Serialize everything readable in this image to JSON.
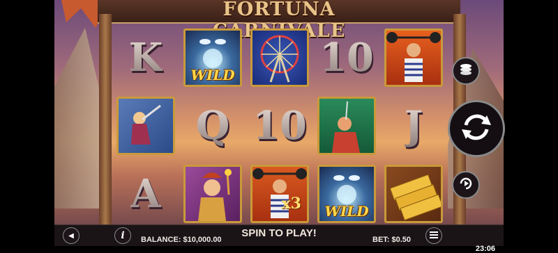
{
  "game": {
    "title": "FORTUNA CARNIVALE"
  },
  "reels": [
    [
      {
        "symbol": "K",
        "kind": "letter"
      },
      {
        "symbol": "aerialist",
        "kind": "tile"
      },
      {
        "symbol": "A",
        "kind": "letter"
      }
    ],
    [
      {
        "symbol": "fortune-teller",
        "kind": "tile",
        "label": "WILD"
      },
      {
        "symbol": "Q",
        "kind": "letter"
      },
      {
        "symbol": "fire-eater",
        "kind": "tile"
      }
    ],
    [
      {
        "symbol": "ferris-wheel",
        "kind": "tile"
      },
      {
        "symbol": "10",
        "kind": "letter"
      },
      {
        "symbol": "strongman",
        "kind": "tile",
        "label": "x3"
      }
    ],
    [
      {
        "symbol": "10",
        "kind": "letter"
      },
      {
        "symbol": "sword-swallower",
        "kind": "tile"
      },
      {
        "symbol": "fortune-teller",
        "kind": "tile",
        "label": "WILD"
      }
    ],
    [
      {
        "symbol": "strongman",
        "kind": "tile"
      },
      {
        "symbol": "J",
        "kind": "letter"
      },
      {
        "symbol": "tickets",
        "kind": "tile"
      }
    ]
  ],
  "bottom_bar": {
    "balance_label": "BALANCE: $10,000.00",
    "message": "SPIN TO PLAY!",
    "bet_label": "BET: $0.50"
  },
  "status": {
    "clock": "23:06"
  },
  "icons": {
    "coins": "coins-icon",
    "spin": "spin-icon",
    "autoplay": "autoplay-icon",
    "info": "info-icon",
    "menu": "menu-icon",
    "sound": "sound-icon"
  }
}
